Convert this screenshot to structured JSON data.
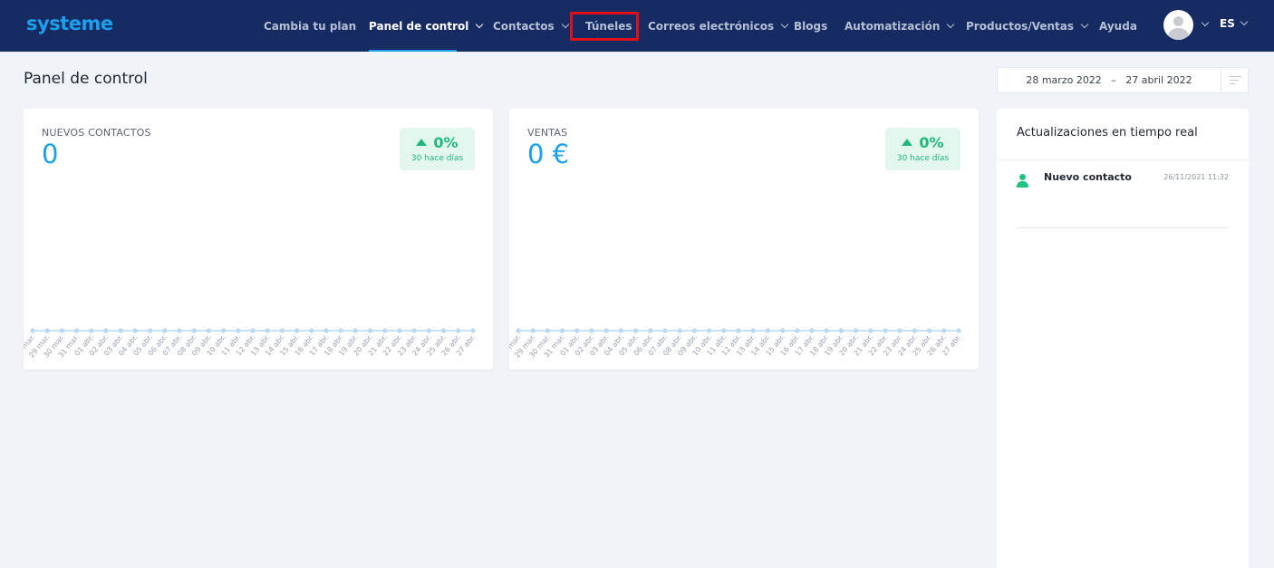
{
  "app": {
    "logo": "systeme"
  },
  "nav": {
    "items": [
      {
        "label": "Cambia tu plan",
        "dropdown": false,
        "active": false
      },
      {
        "label": "Panel de control",
        "dropdown": true,
        "active": true
      },
      {
        "label": "Contactos",
        "dropdown": true,
        "active": false
      },
      {
        "label": "Túneles",
        "dropdown": false,
        "active": false,
        "highlighted": true
      },
      {
        "label": "Correos electrónicos",
        "dropdown": true,
        "active": false
      },
      {
        "label": "Blogs",
        "dropdown": false,
        "active": false
      },
      {
        "label": "Automatización",
        "dropdown": true,
        "active": false
      },
      {
        "label": "Productos/Ventas",
        "dropdown": true,
        "active": false
      },
      {
        "label": "Ayuda",
        "dropdown": false,
        "active": false
      }
    ],
    "language": "ES",
    "colors": {
      "background": "#172b63",
      "accent": "#1ba0ee",
      "highlight": "#e0101a"
    }
  },
  "page": {
    "title": "Panel de control",
    "date_from": "28 marzo 2022",
    "date_separator": "–",
    "date_to": "27 abril 2022"
  },
  "cards": [
    {
      "label": "NUEVOS CONTACTOS",
      "value": "0",
      "change": "0%",
      "change_caption": "30 hace días"
    },
    {
      "label": "VENTAS",
      "value": "0 €",
      "change": "0%",
      "change_caption": "30 hace días"
    }
  ],
  "chart_data": [
    {
      "type": "line",
      "x": [
        "28 mar.",
        "29 mar.",
        "30 mar.",
        "31 mar.",
        "01 abr.",
        "02 abr.",
        "03 abr.",
        "04 abr.",
        "05 abr.",
        "06 abr.",
        "07 abr.",
        "08 abr.",
        "09 abr.",
        "10 abr.",
        "11 abr.",
        "12 abr.",
        "13 abr.",
        "14 abr.",
        "15 abr.",
        "16 abr.",
        "17 abr.",
        "18 abr.",
        "19 abr.",
        "20 abr.",
        "21 abr.",
        "22 abr.",
        "23 abr.",
        "24 abr.",
        "25 abr.",
        "26 abr.",
        "27 abr."
      ],
      "series": [
        {
          "values": [
            0,
            0,
            0,
            0,
            0,
            0,
            0,
            0,
            0,
            0,
            0,
            0,
            0,
            0,
            0,
            0,
            0,
            0,
            0,
            0,
            0,
            0,
            0,
            0,
            0,
            0,
            0,
            0,
            0,
            0,
            0
          ]
        }
      ],
      "color": "#b9d8f2"
    },
    {
      "type": "line",
      "x": [
        "28 mar.",
        "29 mar.",
        "30 mar.",
        "31 mar.",
        "01 abr.",
        "02 abr.",
        "03 abr.",
        "04 abr.",
        "05 abr.",
        "06 abr.",
        "07 abr.",
        "08 abr.",
        "09 abr.",
        "10 abr.",
        "11 abr.",
        "12 abr.",
        "13 abr.",
        "14 abr.",
        "15 abr.",
        "16 abr.",
        "17 abr.",
        "18 abr.",
        "19 abr.",
        "20 abr.",
        "21 abr.",
        "22 abr.",
        "23 abr.",
        "24 abr.",
        "25 abr.",
        "26 abr.",
        "27 abr."
      ],
      "series": [
        {
          "values": [
            0,
            0,
            0,
            0,
            0,
            0,
            0,
            0,
            0,
            0,
            0,
            0,
            0,
            0,
            0,
            0,
            0,
            0,
            0,
            0,
            0,
            0,
            0,
            0,
            0,
            0,
            0,
            0,
            0,
            0,
            0
          ]
        }
      ],
      "color": "#b9d8f2"
    }
  ],
  "realtime": {
    "title": "Actualizaciones en tiempo real",
    "items": [
      {
        "icon": "user-icon",
        "label": "Nuevo contacto",
        "time": "26/11/2021 11:32"
      }
    ]
  }
}
